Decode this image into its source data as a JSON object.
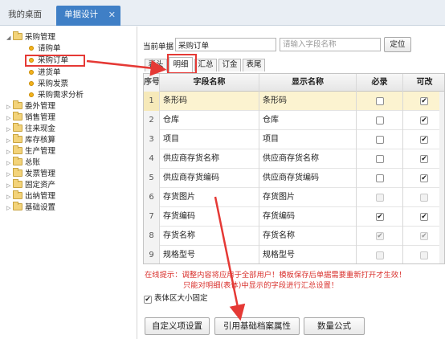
{
  "top_tabs": {
    "home": "我的桌面",
    "active": "单据设计",
    "close": "✕"
  },
  "tree": [
    {
      "label": "采购管理",
      "type": "folder",
      "expanded": true
    },
    {
      "label": "请购单",
      "type": "leaf"
    },
    {
      "label": "采购订单",
      "type": "leaf",
      "selected": true
    },
    {
      "label": "进货单",
      "type": "leaf"
    },
    {
      "label": "采购发票",
      "type": "leaf"
    },
    {
      "label": "采购需求分析",
      "type": "leaf"
    },
    {
      "label": "委外管理",
      "type": "folder"
    },
    {
      "label": "销售管理",
      "type": "folder"
    },
    {
      "label": "往来现金",
      "type": "folder"
    },
    {
      "label": "库存核算",
      "type": "folder"
    },
    {
      "label": "生产管理",
      "type": "folder"
    },
    {
      "label": "总账",
      "type": "folder"
    },
    {
      "label": "发票管理",
      "type": "folder"
    },
    {
      "label": "固定资产",
      "type": "folder"
    },
    {
      "label": "出纳管理",
      "type": "folder"
    },
    {
      "label": "基础设置",
      "type": "folder"
    }
  ],
  "form": {
    "current_label": "当前单据",
    "current_value": "采购订单",
    "search_placeholder": "请输入字段名称",
    "locate_button": "定位"
  },
  "sub_tabs": [
    "表头",
    "明细",
    "汇总",
    "订金",
    "表尾"
  ],
  "sub_tab_active": "明细",
  "grid": {
    "columns": [
      "序号",
      "字段名称",
      "显示名称",
      "必录",
      "可改"
    ],
    "rows": [
      {
        "no": "1",
        "field": "条形码",
        "display": "条形码",
        "required": false,
        "required_disabled": false,
        "editable": true,
        "editable_disabled": false,
        "highlight": true
      },
      {
        "no": "2",
        "field": "仓库",
        "display": "仓库",
        "required": false,
        "required_disabled": false,
        "editable": true,
        "editable_disabled": false
      },
      {
        "no": "3",
        "field": "项目",
        "display": "项目",
        "required": false,
        "required_disabled": false,
        "editable": true,
        "editable_disabled": false
      },
      {
        "no": "4",
        "field": "供应商存货名称",
        "display": "供应商存货名称",
        "required": false,
        "required_disabled": false,
        "editable": true,
        "editable_disabled": false
      },
      {
        "no": "5",
        "field": "供应商存货编码",
        "display": "供应商存货编码",
        "required": false,
        "required_disabled": false,
        "editable": true,
        "editable_disabled": false
      },
      {
        "no": "6",
        "field": "存货图片",
        "display": "存货图片",
        "required": false,
        "required_disabled": true,
        "editable": false,
        "editable_disabled": true
      },
      {
        "no": "7",
        "field": "存货编码",
        "display": "存货编码",
        "required": true,
        "required_disabled": false,
        "editable": true,
        "editable_disabled": false
      },
      {
        "no": "8",
        "field": "存货名称",
        "display": "存货名称",
        "required": true,
        "required_disabled": true,
        "editable": true,
        "editable_disabled": true
      },
      {
        "no": "9",
        "field": "规格型号",
        "display": "规格型号",
        "required": false,
        "required_disabled": true,
        "editable": false,
        "editable_disabled": true
      }
    ]
  },
  "hints": {
    "line1": "在线提示：调整内容将应用于全部用户！模板保存后单据需要重新打开才生效！",
    "line2": "只能对明细(表体)中显示的字段进行汇总设置！"
  },
  "fixed_size": {
    "label": "表体区大小固定",
    "checked": true
  },
  "buttons": {
    "custom": "自定义项设置",
    "ref": "引用基础档案属性",
    "formula": "数量公式"
  },
  "annotation_color": "#e53935"
}
